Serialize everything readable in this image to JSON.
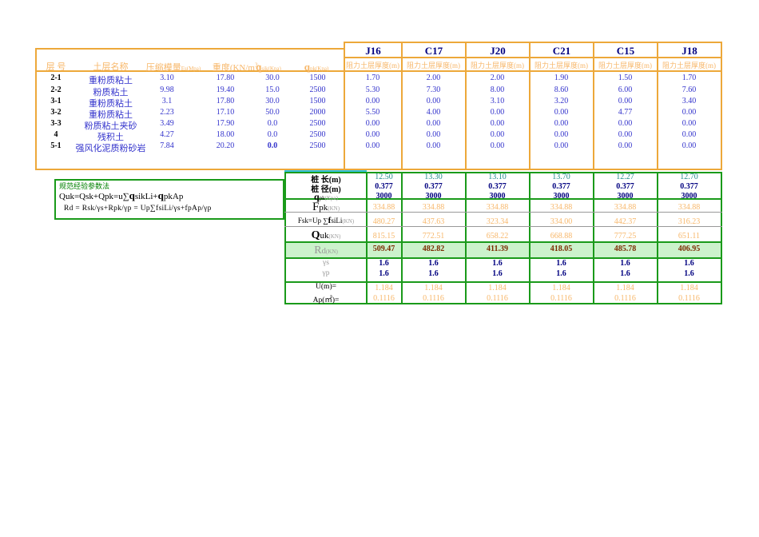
{
  "soil_table": {
    "headers": [
      "层  号",
      "土层名称",
      "压缩模量Es(Mpa)",
      "重度(KN/m³)",
      "qsik(Kpa)",
      "qpk(Kpa)"
    ],
    "header_parts": {
      "h1": "层  号",
      "h2": "土层名称",
      "h3_main": "压缩模量",
      "h3_sub": "Es(Mpa)",
      "h4": "重度(KN/m",
      "h4_sup": "3",
      "h4_tail": ")",
      "h5_q": "q",
      "h5_sub": "sik",
      "h5_unit": "(Kpa)",
      "h6_q": "q",
      "h6_sub": "pk",
      "h6_unit": "(Kpa)"
    },
    "rows": [
      {
        "no": "2-1",
        "name": "重粉质粘土",
        "es": "3.10",
        "gamma": "17.80",
        "qsik": "30.0",
        "qpk": "1500"
      },
      {
        "no": "2-2",
        "name": "粉质粘土",
        "es": "9.98",
        "gamma": "19.40",
        "qsik": "15.0",
        "qpk": "2500"
      },
      {
        "no": "3-1",
        "name": "重粉质粘土",
        "es": "3.1",
        "gamma": "17.80",
        "qsik": "30.0",
        "qpk": "1500"
      },
      {
        "no": "3-2",
        "name": "重粉质粘土",
        "es": "2.23",
        "gamma": "17.10",
        "qsik": "50.0",
        "qpk": "2000"
      },
      {
        "no": "3-3",
        "name": "粉质粘土夹砂",
        "es": "3.49",
        "gamma": "17.90",
        "qsik": "0.0",
        "qpk": "2500"
      },
      {
        "no": "4",
        "name": "残积土",
        "es": "4.27",
        "gamma": "18.00",
        "qsik": "0.0",
        "qpk": "2500"
      },
      {
        "no": "5-1",
        "name": "强风化泥质粉砂岩",
        "es": "7.84",
        "gamma": "20.20",
        "qsik": "0.0",
        "qpk": "2500"
      }
    ]
  },
  "boreholes": {
    "names": [
      "J16",
      "C17",
      "J20",
      "C21",
      "C15",
      "J18"
    ],
    "sub_header": "阻力土层厚度(m)",
    "thickness": [
      [
        "1.70",
        "2.00",
        "2.00",
        "1.90",
        "1.50",
        "1.70"
      ],
      [
        "5.30",
        "7.30",
        "8.00",
        "8.60",
        "6.00",
        "7.60"
      ],
      [
        "0.00",
        "0.00",
        "3.10",
        "3.20",
        "0.00",
        "3.40"
      ],
      [
        "5.50",
        "4.00",
        "0.00",
        "0.00",
        "4.77",
        "0.00"
      ],
      [
        "0.00",
        "0.00",
        "0.00",
        "0.00",
        "0.00",
        "0.00"
      ],
      [
        "0.00",
        "0.00",
        "0.00",
        "0.00",
        "0.00",
        "0.00"
      ],
      [
        "0.00",
        "0.00",
        "0.00",
        "0.00",
        "0.00",
        "0.00"
      ]
    ]
  },
  "formula": {
    "title": "规范经验参数法",
    "line1": "Quk=Qsk+Qpk=u∑qsikLi+qpkAp",
    "line1_parts": {
      "a": "Quk=Qsk+Qpk=u",
      "sigma": "∑",
      "q1": "q",
      "sub1": "sikLi+",
      "q2": "q",
      "sub2": "pkAp"
    },
    "line2": "Rd = Rsk/γs+Rpk/γp = Up∑fsiLi/γs+fpAp/γp"
  },
  "results": {
    "row_labels": {
      "pile_length": "桩   长(m)",
      "pile_diameter": "桩  径(m)",
      "qpk": "qpk(Kpa)",
      "qpk_q": "q",
      "qpk_sub": "pk",
      "qpk_unit": "(Kpa)",
      "fpk": "Fpk(KN)",
      "fpk_f": "F",
      "fpk_sub": "pk",
      "fpk_unit": "(KN)",
      "fsk": "Fsk=Up∑fsiLi(KN)",
      "fsk_a": "Fsk=Up ",
      "fsk_sigma": "∑",
      "fsk_f": "f",
      "fsk_sub": "siLi",
      "fsk_unit": "(KN)",
      "quk": "Quk(KN)",
      "quk_q": "Q",
      "quk_sub": "uk",
      "quk_unit": "(KN)",
      "rd": "Rd(KN)",
      "rd_r": "R",
      "rd_sub": "d",
      "rd_unit": "(KN)",
      "gamma_s": "γs",
      "gamma_p": "γp",
      "u": "U(m)=",
      "ap": "Ap(㎡)="
    },
    "pile_length": [
      "12.50",
      "13.30",
      "13.10",
      "13.70",
      "12.27",
      "12.70"
    ],
    "pile_diameter": [
      "0.377",
      "0.377",
      "0.377",
      "0.377",
      "0.377",
      "0.377"
    ],
    "qpk": [
      "3000",
      "3000",
      "3000",
      "3000",
      "3000",
      "3000"
    ],
    "fpk": [
      "334.88",
      "334.88",
      "334.88",
      "334.88",
      "334.88",
      "334.88"
    ],
    "fsk": [
      "480.27",
      "437.63",
      "323.34",
      "334.00",
      "442.37",
      "316.23"
    ],
    "quk": [
      "815.15",
      "772.51",
      "658.22",
      "668.88",
      "777.25",
      "651.11"
    ],
    "rd": [
      "509.47",
      "482.82",
      "411.39",
      "418.05",
      "485.78",
      "406.95"
    ],
    "gamma_s": [
      "1.6",
      "1.6",
      "1.6",
      "1.6",
      "1.6",
      "1.6"
    ],
    "gamma_p": [
      "1.6",
      "1.6",
      "1.6",
      "1.6",
      "1.6",
      "1.6"
    ],
    "u": [
      "1.184",
      "1.184",
      "1.184",
      "1.184",
      "1.184",
      "1.184"
    ],
    "ap": [
      "0.1116",
      "0.1116",
      "0.1116",
      "0.1116",
      "0.1116",
      "0.1116"
    ]
  },
  "colors": {
    "orange_border": "#eda83a",
    "green_border": "#1a9a1a",
    "blue_text": "#3333cc",
    "orange_text": "#f7b76a",
    "teal_text": "#1f8a8a",
    "highlight_green": "#ccf2cc"
  }
}
